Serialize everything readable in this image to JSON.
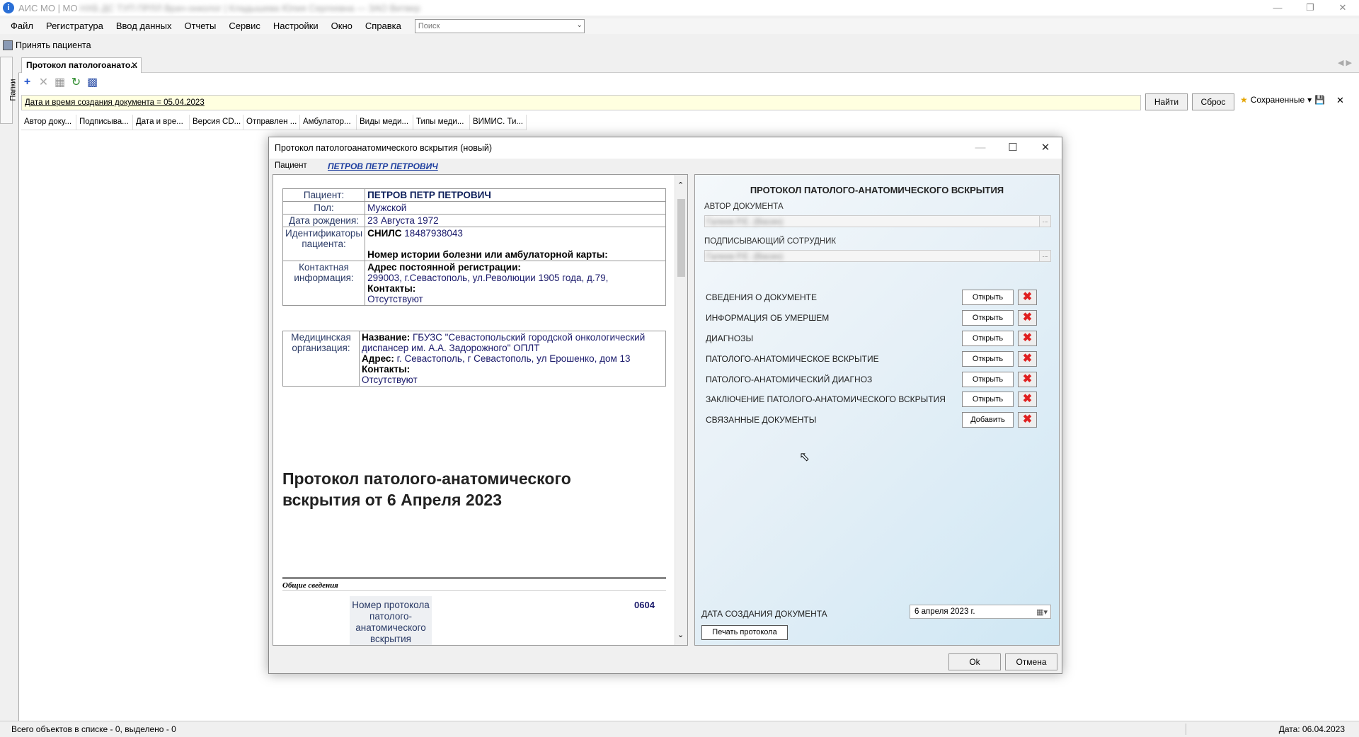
{
  "window": {
    "title_visible": "АИС МО | МО",
    "title_blurred": "НХБ ДС ТУП ПРЛЛ Врач-онколог | Кладышева Юлия Сергеевна — ЗАО Витвер"
  },
  "menu": {
    "items": [
      "Файл",
      "Регистратура",
      "Ввод данных",
      "Отчеты",
      "Сервис",
      "Настройки",
      "Окно",
      "Справка"
    ],
    "search_placeholder": "Поиск"
  },
  "toolbar": {
    "accept_patient": "Принять пациента"
  },
  "side_tab": {
    "label": "Папки"
  },
  "doc_tab": {
    "label": "Протокол патологоанато..."
  },
  "filter": {
    "text": "Дата и время создания документа = 05.04.2023",
    "find": "Найти",
    "reset": "Сброс",
    "saved": "Сохраненные"
  },
  "columns": [
    "Автор доку...",
    "Подписыва...",
    "Дата и вре...",
    "Версия CD...",
    "Отправлен ...",
    "Амбулатор...",
    "Виды меди...",
    "Типы меди...",
    "ВИМИС. Ти..."
  ],
  "status": {
    "left": "Всего объектов в списке - 0, выделено - 0",
    "right": "Дата: 06.04.2023"
  },
  "dialog": {
    "title": "Протокол патологоанатомического вскрытия (новый)",
    "patient_label": "Пациент",
    "patient_link": "ПЕТРОВ ПЕТР ПЕТРОВИЧ",
    "patient_table": {
      "patient_lbl": "Пациент:",
      "patient_val": "ПЕТРОВ ПЕТР ПЕТРОВИЧ",
      "sex_lbl": "Пол:",
      "sex_val": "Мужской",
      "dob_lbl": "Дата рождения:",
      "dob_val": "23 Августа 1972",
      "ids_lbl": "Идентификаторы пациента:",
      "snils_lbl": "СНИЛС",
      "snils_val": "18487938043",
      "history_lbl": "Номер истории болезни или амбулаторной карты:",
      "contact_lbl": "Контактная информация:",
      "addr_lbl": "Адрес постоянной регистрации:",
      "addr_val": "299003, г.Севастополь, ул.Революции 1905 года, д.79,",
      "contacts_lbl": "Контакты:",
      "contacts_val": "Отсутствуют"
    },
    "org_table": {
      "org_lbl": "Медицинская организация:",
      "name_lbl": "Название:",
      "name_val": "ГБУЗС \"Севастопольский городской онкологический диспансер им. А.А. Задорожного\" ОПЛТ",
      "addr_lbl": "Адрес:",
      "addr_val": "г. Севастополь, г Севастополь, ул Ерошенко, дом 13",
      "contacts_lbl": "Контакты:",
      "contacts_val": "Отсутствуют"
    },
    "big_title": "Протокол патолого-анатомического вскрытия от 6 Апреля 2023",
    "general_section": "Общие сведения",
    "protocol_num_label": "Номер протокола патолого-анатомического вскрытия",
    "protocol_num_value": "0604",
    "right": {
      "title": "ПРОТОКОЛ ПАТОЛОГО-АНАТОМИЧЕСКОГО ВСКРЫТИЯ",
      "author_lbl": "АВТОР ДОКУМЕНТА",
      "author_val": "Галеев Р.Е. (Васин)",
      "signer_lbl": "ПОДПИСЫВАЮЩИЙ СОТРУДНИК",
      "signer_val": "Галеев Р.Е. (Васин)",
      "sections": [
        {
          "label": "СВЕДЕНИЯ О ДОКУМЕНТЕ",
          "action": "Открыть"
        },
        {
          "label": "ИНФОРМАЦИЯ ОБ УМЕРШЕМ",
          "action": "Открыть"
        },
        {
          "label": "ДИАГНОЗЫ",
          "action": "Открыть"
        },
        {
          "label": "ПАТОЛОГО-АНАТОМИЧЕСКОЕ ВСКРЫТИЕ",
          "action": "Открыть"
        },
        {
          "label": "ПАТОЛОГО-АНАТОМИЧЕСКИЙ ДИАГНОЗ",
          "action": "Открыть"
        },
        {
          "label": "ЗАКЛЮЧЕНИЕ ПАТОЛОГО-АНАТОМИЧЕСКОГО ВСКРЫТИЯ",
          "action": "Открыть"
        },
        {
          "label": "СВЯЗАННЫЕ ДОКУМЕНТЫ",
          "action": "Добавить"
        }
      ],
      "date_lbl": "ДАТА СОЗДАНИЯ ДОКУМЕНТА",
      "date_val": "6  апреля   2023 г.",
      "print_btn": "Печать протокола"
    },
    "ok": "Ok",
    "cancel": "Отмена"
  }
}
